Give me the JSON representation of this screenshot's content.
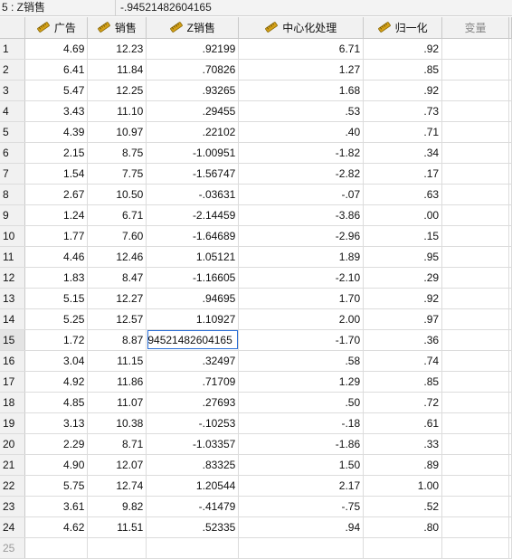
{
  "cell_editor": {
    "reference": "5 : Z销售",
    "value": "-.94521482604165"
  },
  "columns": [
    {
      "label": "广告",
      "icon": "ruler-icon"
    },
    {
      "label": "销售",
      "icon": "ruler-icon"
    },
    {
      "label": "Z销售",
      "icon": "ruler-icon"
    },
    {
      "label": "中心化处理",
      "icon": "ruler-icon"
    },
    {
      "label": "归一化",
      "icon": "ruler-icon"
    },
    {
      "label": "变量",
      "icon": null
    }
  ],
  "rows": [
    {
      "n": "1",
      "cells": [
        "4.69",
        "12.23",
        ".92199",
        "6.71",
        ".92"
      ]
    },
    {
      "n": "2",
      "cells": [
        "6.41",
        "11.84",
        ".70826",
        "1.27",
        ".85"
      ]
    },
    {
      "n": "3",
      "cells": [
        "5.47",
        "12.25",
        ".93265",
        "1.68",
        ".92"
      ]
    },
    {
      "n": "4",
      "cells": [
        "3.43",
        "11.10",
        ".29455",
        ".53",
        ".73"
      ]
    },
    {
      "n": "5",
      "cells": [
        "4.39",
        "10.97",
        ".22102",
        ".40",
        ".71"
      ]
    },
    {
      "n": "6",
      "cells": [
        "2.15",
        "8.75",
        "-1.00951",
        "-1.82",
        ".34"
      ]
    },
    {
      "n": "7",
      "cells": [
        "1.54",
        "7.75",
        "-1.56747",
        "-2.82",
        ".17"
      ]
    },
    {
      "n": "8",
      "cells": [
        "2.67",
        "10.50",
        "-.03631",
        "-.07",
        ".63"
      ]
    },
    {
      "n": "9",
      "cells": [
        "1.24",
        "6.71",
        "-2.14459",
        "-3.86",
        ".00"
      ]
    },
    {
      "n": "10",
      "cells": [
        "1.77",
        "7.60",
        "-1.64689",
        "-2.96",
        ".15"
      ]
    },
    {
      "n": "11",
      "cells": [
        "4.46",
        "12.46",
        "1.05121",
        "1.89",
        ".95"
      ]
    },
    {
      "n": "12",
      "cells": [
        "1.83",
        "8.47",
        "-1.16605",
        "-2.10",
        ".29"
      ]
    },
    {
      "n": "13",
      "cells": [
        "5.15",
        "12.27",
        ".94695",
        "1.70",
        ".92"
      ]
    },
    {
      "n": "14",
      "cells": [
        "5.25",
        "12.57",
        "1.10927",
        "2.00",
        ".97"
      ]
    },
    {
      "n": "15",
      "cells": [
        "1.72",
        "8.87",
        "94521482604165",
        "-1.70",
        ".36"
      ]
    },
    {
      "n": "16",
      "cells": [
        "3.04",
        "11.15",
        ".32497",
        ".58",
        ".74"
      ]
    },
    {
      "n": "17",
      "cells": [
        "4.92",
        "11.86",
        ".71709",
        "1.29",
        ".85"
      ]
    },
    {
      "n": "18",
      "cells": [
        "4.85",
        "11.07",
        ".27693",
        ".50",
        ".72"
      ]
    },
    {
      "n": "19",
      "cells": [
        "3.13",
        "10.38",
        "-.10253",
        "-.18",
        ".61"
      ]
    },
    {
      "n": "20",
      "cells": [
        "2.29",
        "8.71",
        "-1.03357",
        "-1.86",
        ".33"
      ]
    },
    {
      "n": "21",
      "cells": [
        "4.90",
        "12.07",
        ".83325",
        "1.50",
        ".89"
      ]
    },
    {
      "n": "22",
      "cells": [
        "5.75",
        "12.74",
        "1.20544",
        "2.17",
        "1.00"
      ]
    },
    {
      "n": "23",
      "cells": [
        "3.61",
        "9.82",
        "-.41479",
        "-.75",
        ".52"
      ]
    },
    {
      "n": "24",
      "cells": [
        "4.62",
        "11.51",
        ".52335",
        ".94",
        ".80"
      ]
    },
    {
      "n": "25",
      "cells": [
        "",
        "",
        "",
        "",
        ""
      ]
    }
  ],
  "current_row_index": 14,
  "editing_cell": {
    "row_index": 14,
    "col_index": 2
  },
  "colors": {
    "selection_outline": "#2a6ed6",
    "ruler_icon": "#d4a017"
  }
}
